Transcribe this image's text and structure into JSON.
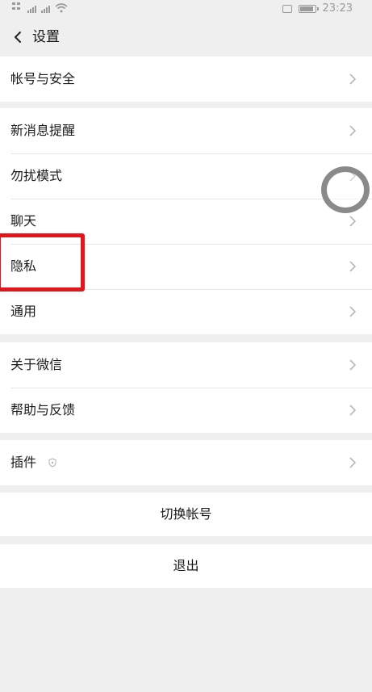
{
  "status_bar": {
    "time": "23:23",
    "icons": [
      "sim-icon",
      "signal-icon",
      "signal-icon",
      "wifi-icon",
      "vibrate-icon",
      "battery-icon"
    ]
  },
  "header": {
    "title": "设置",
    "back_icon": "chevron-left-icon"
  },
  "groups": [
    {
      "items": [
        {
          "label": "帐号与安全"
        }
      ]
    },
    {
      "items": [
        {
          "label": "新消息提醒"
        },
        {
          "label": "勿扰模式"
        },
        {
          "label": "聊天"
        },
        {
          "label": "隐私"
        },
        {
          "label": "通用"
        }
      ]
    },
    {
      "items": [
        {
          "label": "关于微信"
        },
        {
          "label": "帮助与反馈"
        }
      ]
    },
    {
      "items": [
        {
          "label": "插件"
        }
      ]
    }
  ],
  "actions": {
    "switch_account": "切换帐号",
    "logout": "退出"
  },
  "colors": {
    "background": "#efeff0",
    "row_background": "#ffffff",
    "highlight": "#e3151c",
    "chevron": "#b8b8b8"
  }
}
